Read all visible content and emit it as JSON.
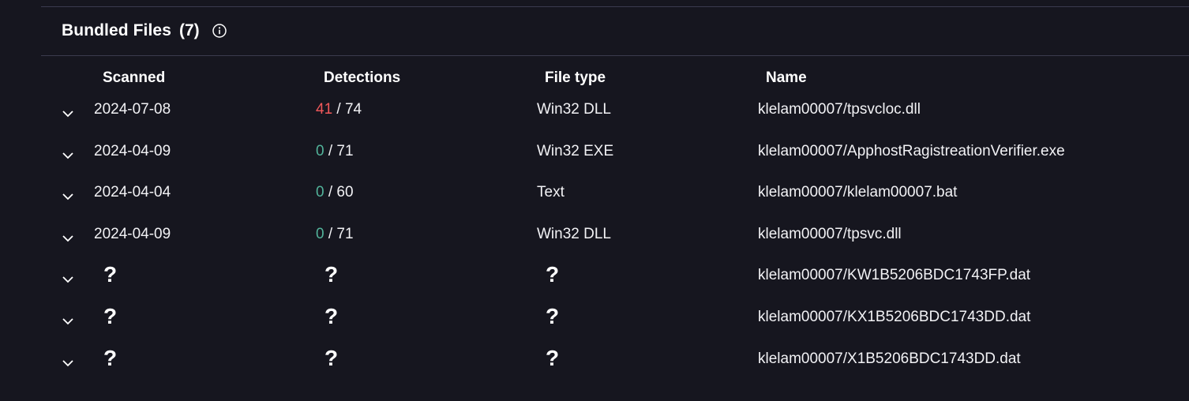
{
  "section": {
    "title": "Bundled Files",
    "count": "(7)",
    "info_icon": "info-circle-icon"
  },
  "columns": {
    "scanned": "Scanned",
    "detections": "Detections",
    "file_type": "File type",
    "name": "Name"
  },
  "colors": {
    "background": "#16161f",
    "detections_positive": "#f0585a",
    "detections_zero": "#52b39a",
    "divider": "#3b3b4e"
  },
  "rows": [
    {
      "scanned": "2024-07-08",
      "detections": "41",
      "total": "74",
      "file_type": "Win32 DLL",
      "name": "klelam00007/tpsvcloc.dll",
      "known": true
    },
    {
      "scanned": "2024-04-09",
      "detections": "0",
      "total": "71",
      "file_type": "Win32 EXE",
      "name": "klelam00007/ApphostRagistreationVerifier.exe",
      "known": true
    },
    {
      "scanned": "2024-04-04",
      "detections": "0",
      "total": "60",
      "file_type": "Text",
      "name": "klelam00007/klelam00007.bat",
      "known": true
    },
    {
      "scanned": "2024-04-09",
      "detections": "0",
      "total": "71",
      "file_type": "Win32 DLL",
      "name": "klelam00007/tpsvc.dll",
      "known": true
    },
    {
      "scanned": "?",
      "detections": "?",
      "total": "",
      "file_type": "?",
      "name": "klelam00007/KW1B5206BDC1743FP.dat",
      "known": false
    },
    {
      "scanned": "?",
      "detections": "?",
      "total": "",
      "file_type": "?",
      "name": "klelam00007/KX1B5206BDC1743DD.dat",
      "known": false
    },
    {
      "scanned": "?",
      "detections": "?",
      "total": "",
      "file_type": "?",
      "name": "klelam00007/X1B5206BDC1743DD.dat",
      "known": false
    }
  ]
}
